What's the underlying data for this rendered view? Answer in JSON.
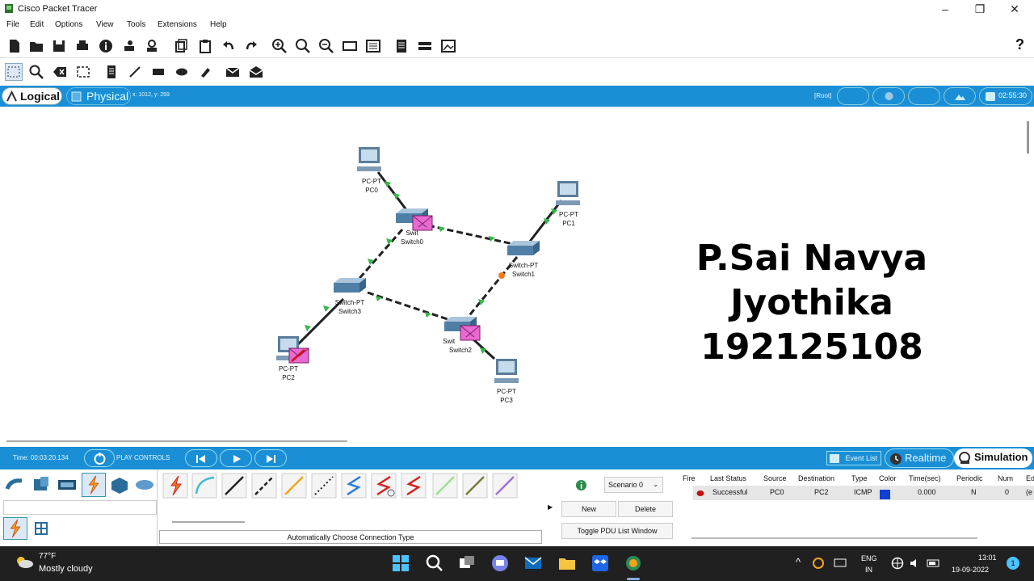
{
  "window": {
    "title": "Cisco Packet Tracer",
    "minimize": "–",
    "maximize": "❐",
    "close": "✕"
  },
  "menu": [
    "File",
    "Edit",
    "Options",
    "View",
    "Tools",
    "Extensions",
    "Help"
  ],
  "help_glyph": "?",
  "view_tabs": {
    "logical": "Logical",
    "physical": "Physical"
  },
  "cursor_coords": "x: 1012, y: 259",
  "root_label": "[Root]",
  "clock": "02:55:30",
  "overlay_text": {
    "line1": "P.Sai Navya",
    "line2": "Jyothika",
    "line3": "192125108"
  },
  "topology": {
    "devices": [
      {
        "id": "pc0",
        "type": "PC-PT",
        "name": "PC0"
      },
      {
        "id": "pc1",
        "type": "PC-PT",
        "name": "PC1"
      },
      {
        "id": "pc2",
        "type": "PC-PT",
        "name": "PC2"
      },
      {
        "id": "pc3",
        "type": "PC-PT",
        "name": "PC3"
      },
      {
        "id": "switch0",
        "type": "Switch-PT",
        "name": "Switch0"
      },
      {
        "id": "switch1",
        "type": "Switch-PT",
        "name": "Switch1"
      },
      {
        "id": "switch2",
        "type": "Switch-PT",
        "name": "Switch2"
      },
      {
        "id": "switch3",
        "type": "Switch-PT",
        "name": "Switch3"
      }
    ],
    "switch_type_labels": {
      "switch0": "Swit",
      "switch2": "Swit"
    }
  },
  "sim_bar": {
    "time": "Time: 00:03:20.134",
    "play_controls": "PLAY CONTROLS",
    "event_list": "Event List",
    "realtime": "Realtime",
    "simulation": "Simulation"
  },
  "connections_caption": "Automatically Choose Connection Type",
  "scenario": {
    "select": "Scenario 0",
    "new": "New",
    "delete": "Delete",
    "toggle": "Toggle PDU List Window"
  },
  "pdu_table": {
    "headers": [
      "Fire",
      "Last Status",
      "Source",
      "Destination",
      "Type",
      "Color",
      "Time(sec)",
      "Periodic",
      "Num",
      "Ed"
    ],
    "rows": [
      {
        "last_status": "Successful",
        "source": "PC0",
        "destination": "PC2",
        "type": "ICMP",
        "color": "#1040d0",
        "time": "0.000",
        "periodic": "N",
        "num": "0",
        "ed": "(e"
      }
    ]
  },
  "taskbar": {
    "temperature": "77°F",
    "weather": "Mostly cloudy",
    "lang1": "ENG",
    "lang2": "IN",
    "time": "13:01",
    "date": "19-09-2022",
    "notif_count": "1"
  },
  "colors": {
    "accent": "#1a8fd6",
    "link_ok": "#39b54a",
    "link_blocked": "#f07a1a",
    "envelope": "#e86ad0"
  }
}
